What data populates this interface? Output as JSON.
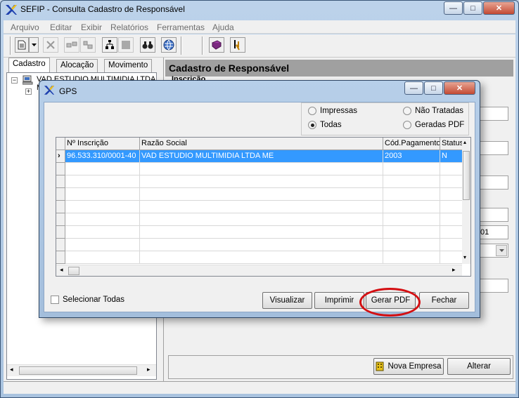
{
  "main_window": {
    "title": "SEFIP - Consulta Cadastro de Responsável",
    "caption_buttons": {
      "minimize": "—",
      "maximize": "□",
      "close": "✕"
    }
  },
  "menu": [
    "Arquivo",
    "Editar",
    "Exibir",
    "Relatórios",
    "Ferramentas",
    "Ajuda"
  ],
  "toolbar": {
    "icons": [
      "new-document-icon",
      "dropdown-arrow-icon",
      "delete-x-icon",
      "import-icon",
      "export-icon",
      "tree-icon",
      "stop-icon",
      "binoculars-icon",
      "globe-icon",
      "book-icon",
      "cursor-exit-icon"
    ]
  },
  "left_tabs": [
    "Cadastro",
    "Alocação",
    "Movimento"
  ],
  "tree": {
    "root_label": "VAD ESTUDIO MULTIMIDIA LTDA ME"
  },
  "right_panel": {
    "header": "Cadastro de Responsável",
    "subheader": "Inscrição",
    "field_fragment": "01"
  },
  "bottom_buttons": {
    "nova_empresa": "Nova Empresa",
    "alterar": "Alterar"
  },
  "gps_dialog": {
    "title": "GPS",
    "caption_buttons": {
      "minimize": "—",
      "maximize": "□",
      "close": "✕"
    },
    "filters": {
      "impressas": "Impressas",
      "todas": "Todas",
      "nao_tratadas": "Não Tratadas",
      "geradas_pdf": "Geradas PDF",
      "selected": "todas"
    },
    "grid": {
      "columns": [
        "Nº Inscrição",
        "Razão Social",
        "Cód.Pagamento",
        "Status"
      ],
      "rows": [
        [
          "96.533.310/0001-40",
          "VAD ESTUDIO MULTIMIDIA LTDA ME",
          "2003",
          "N"
        ]
      ],
      "row_indicator": "›"
    },
    "select_all_label": "Selecionar Todas",
    "buttons": {
      "visualizar": "Visualizar",
      "imprimir": "Imprimir",
      "gerar_pdf": "Gerar PDF",
      "fechar": "Fechar"
    }
  },
  "colors": {
    "title_gradient_top": "#bcd2ea",
    "selection": "#3399ff",
    "highlight_ring": "#d40f12",
    "header_gray": "#a0a0a0"
  }
}
